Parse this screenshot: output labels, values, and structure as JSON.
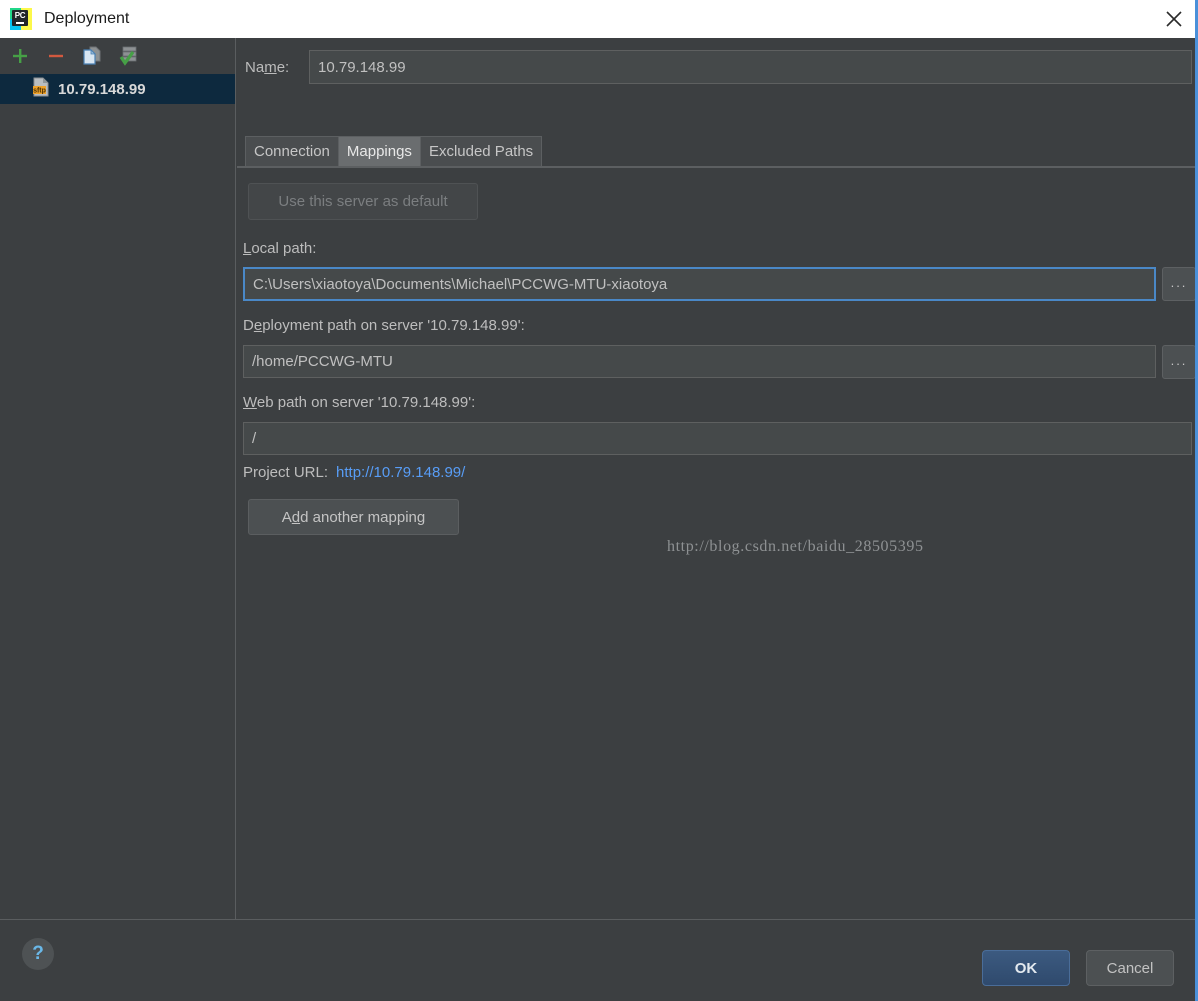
{
  "window": {
    "title": "Deployment",
    "app_icon": "pycharm-logo-icon",
    "close_icon": "close-icon"
  },
  "sidebar": {
    "toolbar": [
      {
        "name": "add-server-button",
        "icon": "plus-icon",
        "label": "+"
      },
      {
        "name": "remove-server-button",
        "icon": "minus-icon",
        "label": "−"
      },
      {
        "name": "copy-server-button",
        "icon": "copy-icon",
        "label": ""
      },
      {
        "name": "set-default-server-button",
        "icon": "server-check-icon",
        "label": ""
      }
    ],
    "servers": [
      {
        "name": "10.79.148.99",
        "icon": "sftp-file-icon",
        "selected": true
      }
    ]
  },
  "main": {
    "name_label": "Na",
    "name_label_mnemonic": "m",
    "name_label_rest": "e:",
    "name_value": "10.79.148.99",
    "tabs": [
      {
        "label": "Connection",
        "active": false
      },
      {
        "label": "Mappings",
        "active": true
      },
      {
        "label": "Excluded Paths",
        "active": false
      }
    ],
    "use_default_button": "Use this server as default",
    "local_path": {
      "label_mnemonic": "L",
      "label_rest": "ocal path:",
      "value": "C:\\Users\\xiaotoya\\Documents\\Michael\\PCCWG-MTU-xiaotoya",
      "browse_label": "..."
    },
    "deployment_path": {
      "label_pre": "D",
      "label_mnemonic": "e",
      "label_rest": "ployment path on server '10.79.148.99':",
      "value": "/home/PCCWG-MTU",
      "browse_label": "..."
    },
    "web_path": {
      "label_mnemonic": "W",
      "label_rest": "eb path on server '10.79.148.99':",
      "value": "/"
    },
    "project_url_label": "Project URL:",
    "project_url_value": "http://10.79.148.99/",
    "add_mapping_button_pre": "A",
    "add_mapping_button_mnemonic": "d",
    "add_mapping_button_rest": "d another mapping",
    "watermark": "http://blog.csdn.net/baidu_28505395"
  },
  "footer": {
    "help_label": "?",
    "ok_label": "OK",
    "cancel_label": "Cancel"
  },
  "colors": {
    "panel_bg": "#3c3f41",
    "selected_row": "#0d293e",
    "accent_blue": "#589df6",
    "focus_border": "#4a88c7",
    "ok_button": "#3c5a80",
    "title_bar": "#ffffff"
  }
}
